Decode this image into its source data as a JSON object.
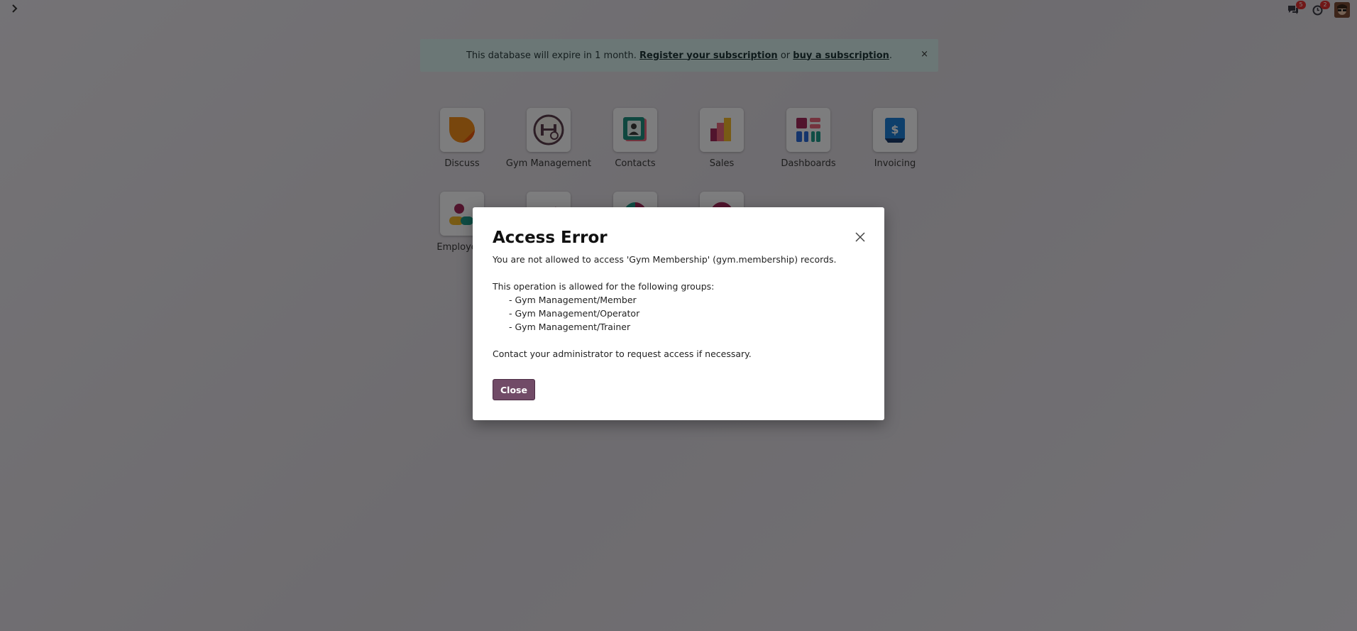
{
  "banner": {
    "text": "This database will expire in 1 month.",
    "link1": "Register your subscription",
    "or": "or",
    "link2": "buy a subscription",
    "period": ".",
    "close": "×"
  },
  "systray": {
    "messages_count": "5",
    "activities_count": "2"
  },
  "apps": [
    {
      "label": "Discuss",
      "icon": "discuss-icon"
    },
    {
      "label": "Gym Management",
      "icon": "gym-icon"
    },
    {
      "label": "Contacts",
      "icon": "contacts-icon"
    },
    {
      "label": "Sales",
      "icon": "sales-icon"
    },
    {
      "label": "Dashboards",
      "icon": "dashboards-icon"
    },
    {
      "label": "Invoicing",
      "icon": "invoicing-icon"
    },
    {
      "label": "Employees",
      "icon": "employees-icon"
    }
  ],
  "dialog": {
    "title": "Access Error",
    "line1": "You are not allowed to access 'Gym Membership' (gym.membership) records.",
    "line2": "This operation is allowed for the following groups:",
    "groups": [
      "- Gym Management/Member",
      "- Gym Management/Operator",
      "- Gym Management/Trainer"
    ],
    "line3": "Contact your administrator to request access if necessary.",
    "close_button": "Close"
  },
  "colors": {
    "primary": "#714b67",
    "banner_bg": "#d7efec",
    "badge": "#e03131"
  }
}
